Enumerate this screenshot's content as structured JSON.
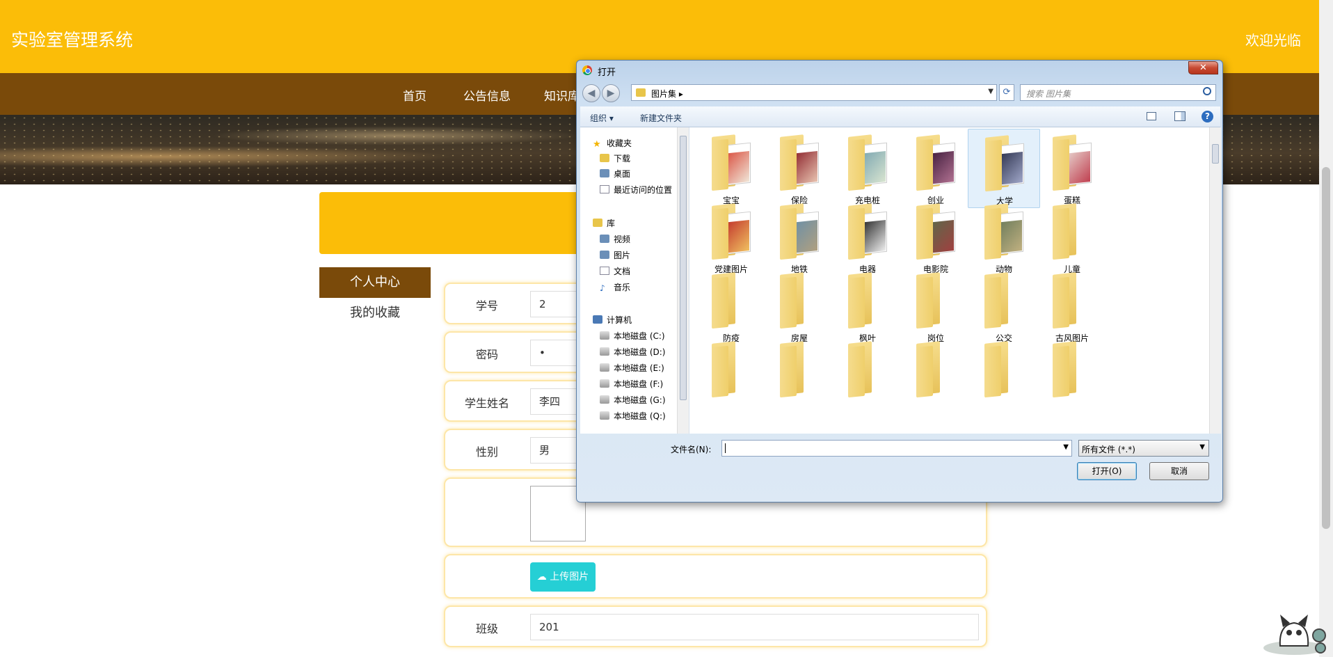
{
  "header": {
    "title": "实验室管理系统",
    "welcome": "欢迎光临"
  },
  "nav": {
    "items": [
      "首页",
      "公告信息",
      "知识库"
    ]
  },
  "sidebar": {
    "active": "个人中心",
    "items": [
      "我的收藏"
    ]
  },
  "form": {
    "fields": [
      {
        "label": "学号",
        "value": "2"
      },
      {
        "label": "密码",
        "value": "•"
      },
      {
        "label": "学生姓名",
        "value": "李四"
      },
      {
        "label": "性别",
        "value": "男"
      },
      {
        "label": "班级",
        "value": "201"
      }
    ],
    "upload_label": "上传图片"
  },
  "dialog": {
    "title": "打开",
    "close": "✕",
    "breadcrumb": "图片集 ▸",
    "search_placeholder": "搜索 图片集",
    "toolbar": {
      "organize": "组织 ▾",
      "new_folder": "新建文件夹"
    },
    "navpane": {
      "favorites": "收藏夹",
      "fav_items": [
        "下载",
        "桌面",
        "最近访问的位置"
      ],
      "library": "库",
      "lib_items": [
        "视频",
        "图片",
        "文档",
        "音乐"
      ],
      "computer": "计算机",
      "drives": [
        "本地磁盘 (C:)",
        "本地磁盘 (D:)",
        "本地磁盘 (E:)",
        "本地磁盘 (F:)",
        "本地磁盘 (G:)",
        "本地磁盘 (Q:)"
      ]
    },
    "folders": [
      "宝宝",
      "保险",
      "充电桩",
      "创业",
      "大学",
      "蛋糕",
      "党建图片",
      "地铁",
      "电器",
      "电影院",
      "动物",
      "儿童",
      "防疫",
      "房屋",
      "枫叶",
      "岗位",
      "公交",
      "古风图片",
      "",
      "",
      "",
      "",
      "",
      ""
    ],
    "selected_folder": "大学",
    "filename_label": "文件名(N):",
    "filename_value": "",
    "filetype": "所有文件 (*.*)",
    "open_button": "打开(O)",
    "cancel_button": "取消"
  }
}
